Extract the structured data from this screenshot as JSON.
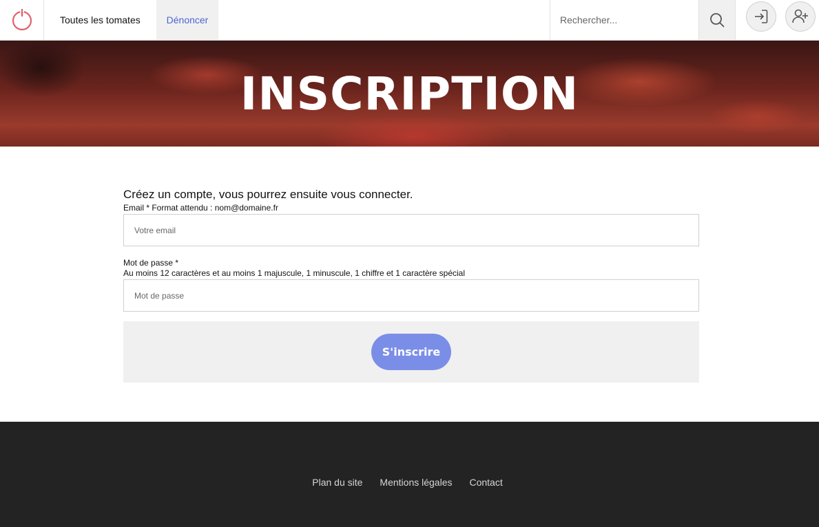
{
  "header": {
    "nav": [
      {
        "label": "Toutes les tomates",
        "active": false
      },
      {
        "label": "Dénoncer",
        "active": true
      }
    ],
    "search": {
      "placeholder": "Rechercher..."
    },
    "icons": {
      "logo": "power-icon",
      "search": "search-icon",
      "login": "login-icon",
      "register": "add-user-icon"
    },
    "colors": {
      "logo": "#e0626a",
      "active_nav": "#4a64d8"
    }
  },
  "hero": {
    "title": "INSCRIPTION"
  },
  "form": {
    "intro": "Créez un compte, vous pourrez ensuite vous connecter.",
    "email": {
      "label": "Email * Format attendu : nom@domaine.fr",
      "placeholder": "Votre email",
      "value": ""
    },
    "password": {
      "label": "Mot de passe *",
      "hint": "Au moins 12 caractères et au moins 1 majuscule, 1 minuscule, 1 chiffre et 1 caractère spécial",
      "placeholder": "Mot de passe",
      "value": ""
    },
    "submit_label": "S'inscrire",
    "submit_color": "#7a8ee8"
  },
  "footer": {
    "links": [
      "Plan du site",
      "Mentions légales",
      "Contact"
    ]
  }
}
